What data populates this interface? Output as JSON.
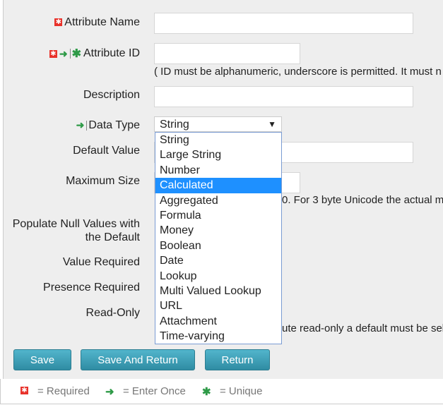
{
  "form": {
    "attribute_name": {
      "label": "Attribute Name",
      "value": ""
    },
    "attribute_id": {
      "label": "Attribute ID",
      "value": "",
      "note": "( ID must be alphanumeric, underscore is permitted. It must n"
    },
    "description": {
      "label": "Description",
      "value": ""
    },
    "data_type": {
      "label": "Data Type",
      "selected": "String",
      "options": [
        "String",
        "Large String",
        "Number",
        "Calculated",
        "Aggregated",
        "Formula",
        "Money",
        "Boolean",
        "Date",
        "Lookup",
        "Multi Valued Lookup",
        "URL",
        "Attachment",
        "Time-varying"
      ],
      "highlighted": "Calculated"
    },
    "default_value": {
      "label": "Default Value",
      "value": ""
    },
    "maximum_size": {
      "label": "Maximum Size",
      "value": "",
      "note": "0. For 3 byte Unicode the actual m"
    },
    "populate_null": {
      "label": "Populate Null Values with the Default"
    },
    "value_required": {
      "label": "Value Required"
    },
    "presence_required": {
      "label": "Presence Required"
    },
    "read_only": {
      "label": "Read-Only",
      "note": "ute read-only a default must be sel"
    }
  },
  "buttons": {
    "save": "Save",
    "save_and_return": "Save And Return",
    "return": "Return"
  },
  "legend": {
    "required": "= Required",
    "enter_once": "= Enter Once",
    "unique": "= Unique"
  }
}
